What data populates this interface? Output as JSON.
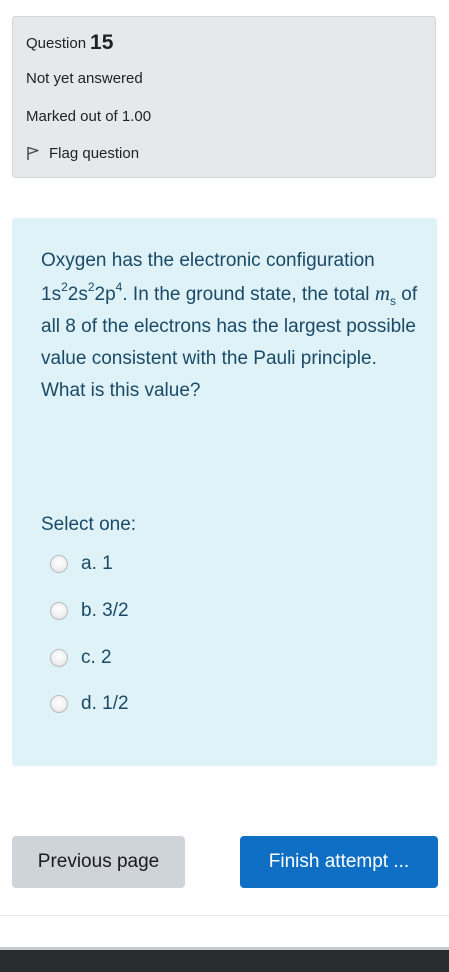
{
  "info": {
    "question_label": "Question",
    "question_number": "15",
    "state": "Not yet answered",
    "grade": "Marked out of 1.00",
    "flag_label": "Flag question"
  },
  "question": {
    "text_p1": "Oxygen has the electronic configuration 1s",
    "sup1": "2",
    "text_p2": "2s",
    "sup2": "2",
    "text_p3": "2p",
    "sup3": "4",
    "text_p4": ". In the ground state, the total ",
    "m_symbol": "m",
    "m_sub": "s",
    "text_p5": " of all 8 of the electrons has the largest possible value consistent with the Pauli principle. What is this value?",
    "prompt": "Select one:",
    "options": [
      {
        "label": "a. 1"
      },
      {
        "label": "b. 3/2"
      },
      {
        "label": "c. 2"
      },
      {
        "label": "d. 1/2"
      }
    ]
  },
  "navigation": {
    "previous": "Previous page",
    "finish": "Finish attempt ..."
  },
  "colors": {
    "accent": "#0f6fc5",
    "question_bg": "#def2f8",
    "info_bg": "#e6e8ea"
  }
}
